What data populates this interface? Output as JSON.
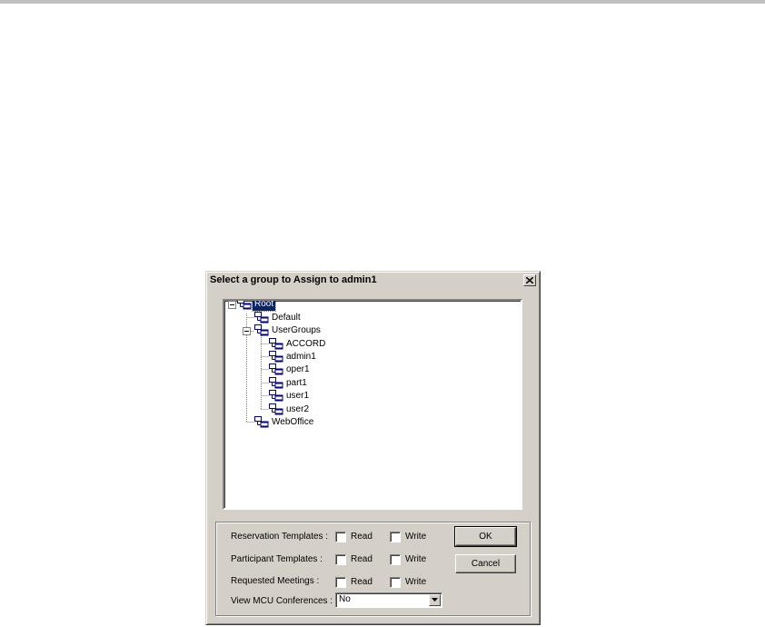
{
  "dialog": {
    "title": "Select a group to Assign to admin1"
  },
  "tree": {
    "root": "Root",
    "default": "Default",
    "user_groups": "UserGroups",
    "children": [
      "ACCORD",
      "admin1",
      "oper1",
      "part1",
      "user1",
      "user2"
    ],
    "web_office": "WebOffice",
    "selected": "Root"
  },
  "permissions": {
    "rows": [
      {
        "label": "Reservation Templates :"
      },
      {
        "label": "Participant Templates  :"
      },
      {
        "label": "Requested Meetings   :"
      }
    ],
    "read_label": "Read",
    "write_label": "Write",
    "view_mcu_label": "View MCU Conferences :",
    "view_mcu_value": "No"
  },
  "buttons": {
    "ok": "OK",
    "cancel": "Cancel"
  },
  "icons": {
    "group": "group-tree-icon",
    "close": "close-icon",
    "dropdown": "chevron-down-icon"
  }
}
